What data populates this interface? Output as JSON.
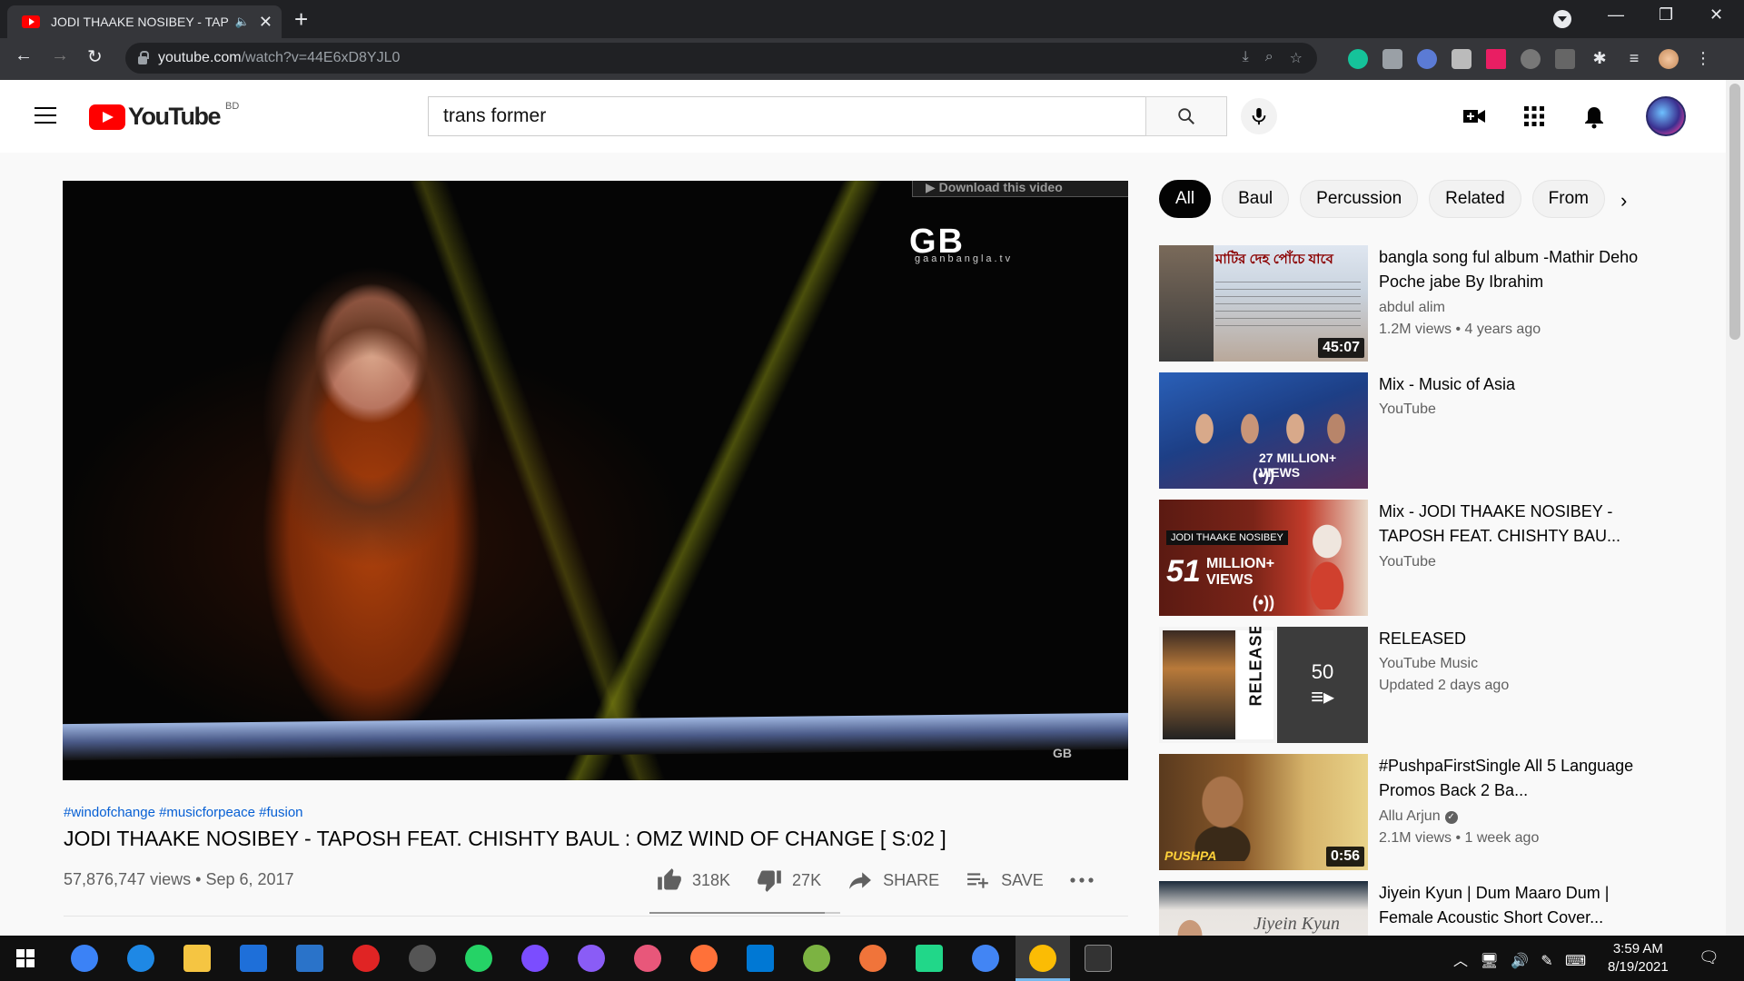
{
  "browser": {
    "tab_title": "JODI THAAKE NOSIBEY - TAP",
    "new_tab": "+",
    "url_host": "youtube.com",
    "url_path": "/watch?v=44E6xD8YJL0",
    "window_minimize": "—",
    "window_restore": "❐",
    "window_close": "✕"
  },
  "youtube": {
    "logo_text": "YouTube",
    "country_code": "BD",
    "search_value": "trans former"
  },
  "player": {
    "download_banner": "Download this video",
    "watermark": "GB",
    "watermark_sub": "gaanbangla.tv",
    "watermark_small": "GB"
  },
  "video": {
    "hashtags": "#windofchange #musicforpeace #fusion",
    "title": "JODI THAAKE NOSIBEY - TAPOSH FEAT. CHISHTY BAUL : OMZ WIND OF CHANGE [ S:02 ]",
    "views": "57,876,747 views",
    "separator": "•",
    "date": "Sep 6, 2017",
    "likes": "318K",
    "dislikes": "27K",
    "share_label": "SHARE",
    "save_label": "SAVE",
    "like_ratio": 0.92
  },
  "chips": [
    "All",
    "Baul",
    "Percussion",
    "Related",
    "From"
  ],
  "recommendations": [
    {
      "title": "bangla song ful album -Mathir Deho Poche jabe By Ibrahim",
      "channel": "abdul alim",
      "meta": "1.2M views • 4 years ago",
      "duration": "45:07",
      "thumb_text": "মাটির দেহ পোঁচে যাবে"
    },
    {
      "title": "Mix - Music of Asia",
      "channel": "YouTube",
      "meta": "",
      "badge": "(•))",
      "thumb_text": "27 MILLION+ VIEWS"
    },
    {
      "title": "Mix - JODI THAAKE NOSIBEY - TAPOSH FEAT. CHISHTY BAU...",
      "channel": "YouTube",
      "meta": "",
      "badge": "(•))",
      "thumb_label": "JODI THAAKE NOSIBEY",
      "thumb_num": "51",
      "thumb_text": "MILLION+ VIEWS"
    },
    {
      "title": "RELEASED",
      "channel": "YouTube Music",
      "meta": "Updated 2 days ago",
      "playlist_count": "50",
      "thumb_text": "RELEASED"
    },
    {
      "title": "#PushpaFirstSingle All 5 Language Promos Back 2 Ba...",
      "channel": "Allu Arjun",
      "meta": "2.1M views • 1 week ago",
      "duration": "0:56",
      "thumb_text": "PUSHPA"
    },
    {
      "title": "Jiyein Kyun | Dum Maaro Dum | Female Acoustic Short Cover...",
      "channel": "",
      "meta": "",
      "thumb_text": "Jiyein Kyun"
    }
  ],
  "system": {
    "time": "3:59 AM",
    "date": "8/19/2021"
  },
  "colors": {
    "youtube_red": "#ff0000",
    "link_blue": "#065fd4",
    "chrome_dark": "#202124"
  }
}
